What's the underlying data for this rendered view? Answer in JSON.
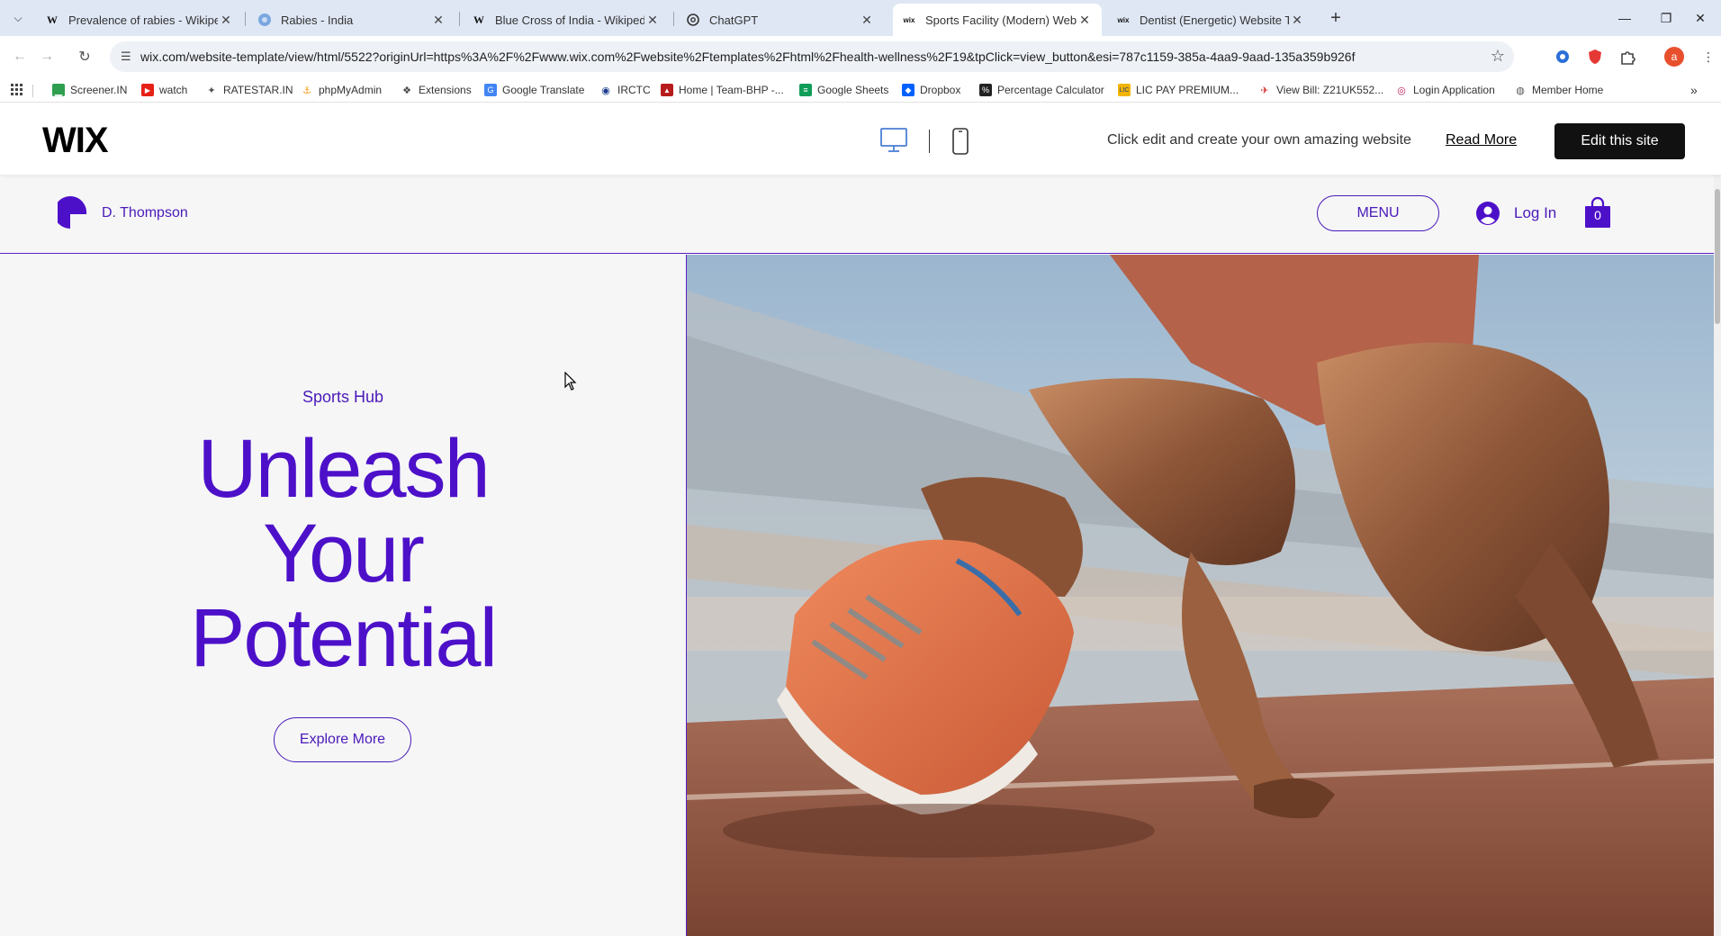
{
  "browser": {
    "tabs": [
      {
        "title": "Prevalence of rabies - Wikipedi",
        "icon": "W",
        "active": false
      },
      {
        "title": "Rabies - India",
        "icon": "globe",
        "active": false
      },
      {
        "title": "Blue Cross of India - Wikipedia",
        "icon": "W",
        "active": false
      },
      {
        "title": "ChatGPT",
        "icon": "chatgpt",
        "active": false
      },
      {
        "title": "Sports Facility (Modern) Websit",
        "icon": "wix",
        "active": true
      },
      {
        "title": "Dentist (Energetic) Website Ten",
        "icon": "wix",
        "active": false
      }
    ],
    "url": "wix.com/website-template/view/html/5522?originUrl=https%3A%2F%2Fwww.wix.com%2Fwebsite%2Ftemplates%2Fhtml%2Fhealth-wellness%2F19&tpClick=view_button&esi=787c1159-385a-4aa9-9aad-135a359b926f",
    "profile_initial": "a",
    "bookmarks": [
      {
        "label": "Screener.IN",
        "icon": "chart-icon",
        "color": "#2e9e4f"
      },
      {
        "label": "watch",
        "icon": "youtube-icon",
        "color": "#e62117"
      },
      {
        "label": "RATESTAR.IN",
        "icon": "ratestar-icon",
        "color": "#555555"
      },
      {
        "label": "phpMyAdmin",
        "icon": "phpmyadmin-icon",
        "color": "#f39c12"
      },
      {
        "label": "Extensions",
        "icon": "puzzle-icon",
        "color": "#444444"
      },
      {
        "label": "Google Translate",
        "icon": "translate-icon",
        "color": "#4285f4"
      },
      {
        "label": "IRCTC",
        "icon": "irctc-icon",
        "color": "#1a3b8c"
      },
      {
        "label": "Home | Team-BHP -...",
        "icon": "teambhp-icon",
        "color": "#b71c1c"
      },
      {
        "label": "Google Sheets",
        "icon": "sheets-icon",
        "color": "#0f9d58"
      },
      {
        "label": "Dropbox",
        "icon": "dropbox-icon",
        "color": "#0061fe"
      },
      {
        "label": "Percentage Calculator",
        "icon": "percent-icon",
        "color": "#222222"
      },
      {
        "label": "LIC PAY PREMIUM...",
        "icon": "lic-icon",
        "color": "#f2b400"
      },
      {
        "label": "View Bill: Z21UK552...",
        "icon": "bill-icon",
        "color": "#d32f2f"
      },
      {
        "label": "Login Application",
        "icon": "login-app-icon",
        "color": "#c2185b"
      },
      {
        "label": "Member Home",
        "icon": "globe-icon",
        "color": "#555555"
      }
    ]
  },
  "wix_bar": {
    "logo": "WIX",
    "message": "Click edit and create your own amazing website",
    "read_more": "Read More",
    "edit_button": "Edit this site"
  },
  "site": {
    "brand_name": "D. Thompson",
    "menu_label": "MENU",
    "login_label": "Log In",
    "cart_count": "0",
    "hero": {
      "eyebrow": "Sports Hub",
      "headline_lines": [
        "Unleash",
        "Your",
        "Potential"
      ],
      "cta": "Explore More"
    },
    "accent_color": "#4d10c9"
  }
}
